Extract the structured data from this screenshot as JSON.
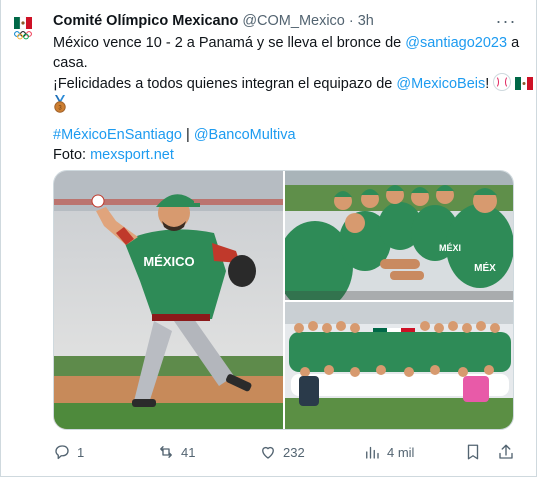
{
  "tweet": {
    "author_name": "Comité Olímpico Mexicano",
    "handle": "@COM_Mexico",
    "separator": "·",
    "time": "3h",
    "more_label": "···",
    "line1_text": "México vence 10 - 2 a Panamá y se lleva el bronce de ",
    "line1_link": "@santiago2023",
    "line1_tail": " a",
    "line2_text": "casa.",
    "line3_text": "¡Felicidades a todos quienes integran el equipazo de ",
    "line3_link": "@MexicoBeis",
    "line3_tail": "!",
    "hashtag": "#MéxicoEnSantiago",
    "hashtag_sep": " | ",
    "bank_link": "@BancoMultiva",
    "foto_label": "Foto: ",
    "foto_link": "mexsport.net"
  },
  "actions": {
    "replies": "1",
    "retweets": "41",
    "likes": "232",
    "views": "4 mil"
  },
  "colors": {
    "link": "#1d9bf0",
    "secondary_text": "#536471",
    "jersey_green": "#2e8b57",
    "field_green": "#4a8c3a"
  },
  "icons": {
    "avatar": "mexican-olympic-committee-logo",
    "reply": "reply-icon",
    "retweet": "retweet-icon",
    "like": "heart-icon",
    "views": "views-icon",
    "bookmark": "bookmark-icon",
    "share": "share-icon"
  }
}
